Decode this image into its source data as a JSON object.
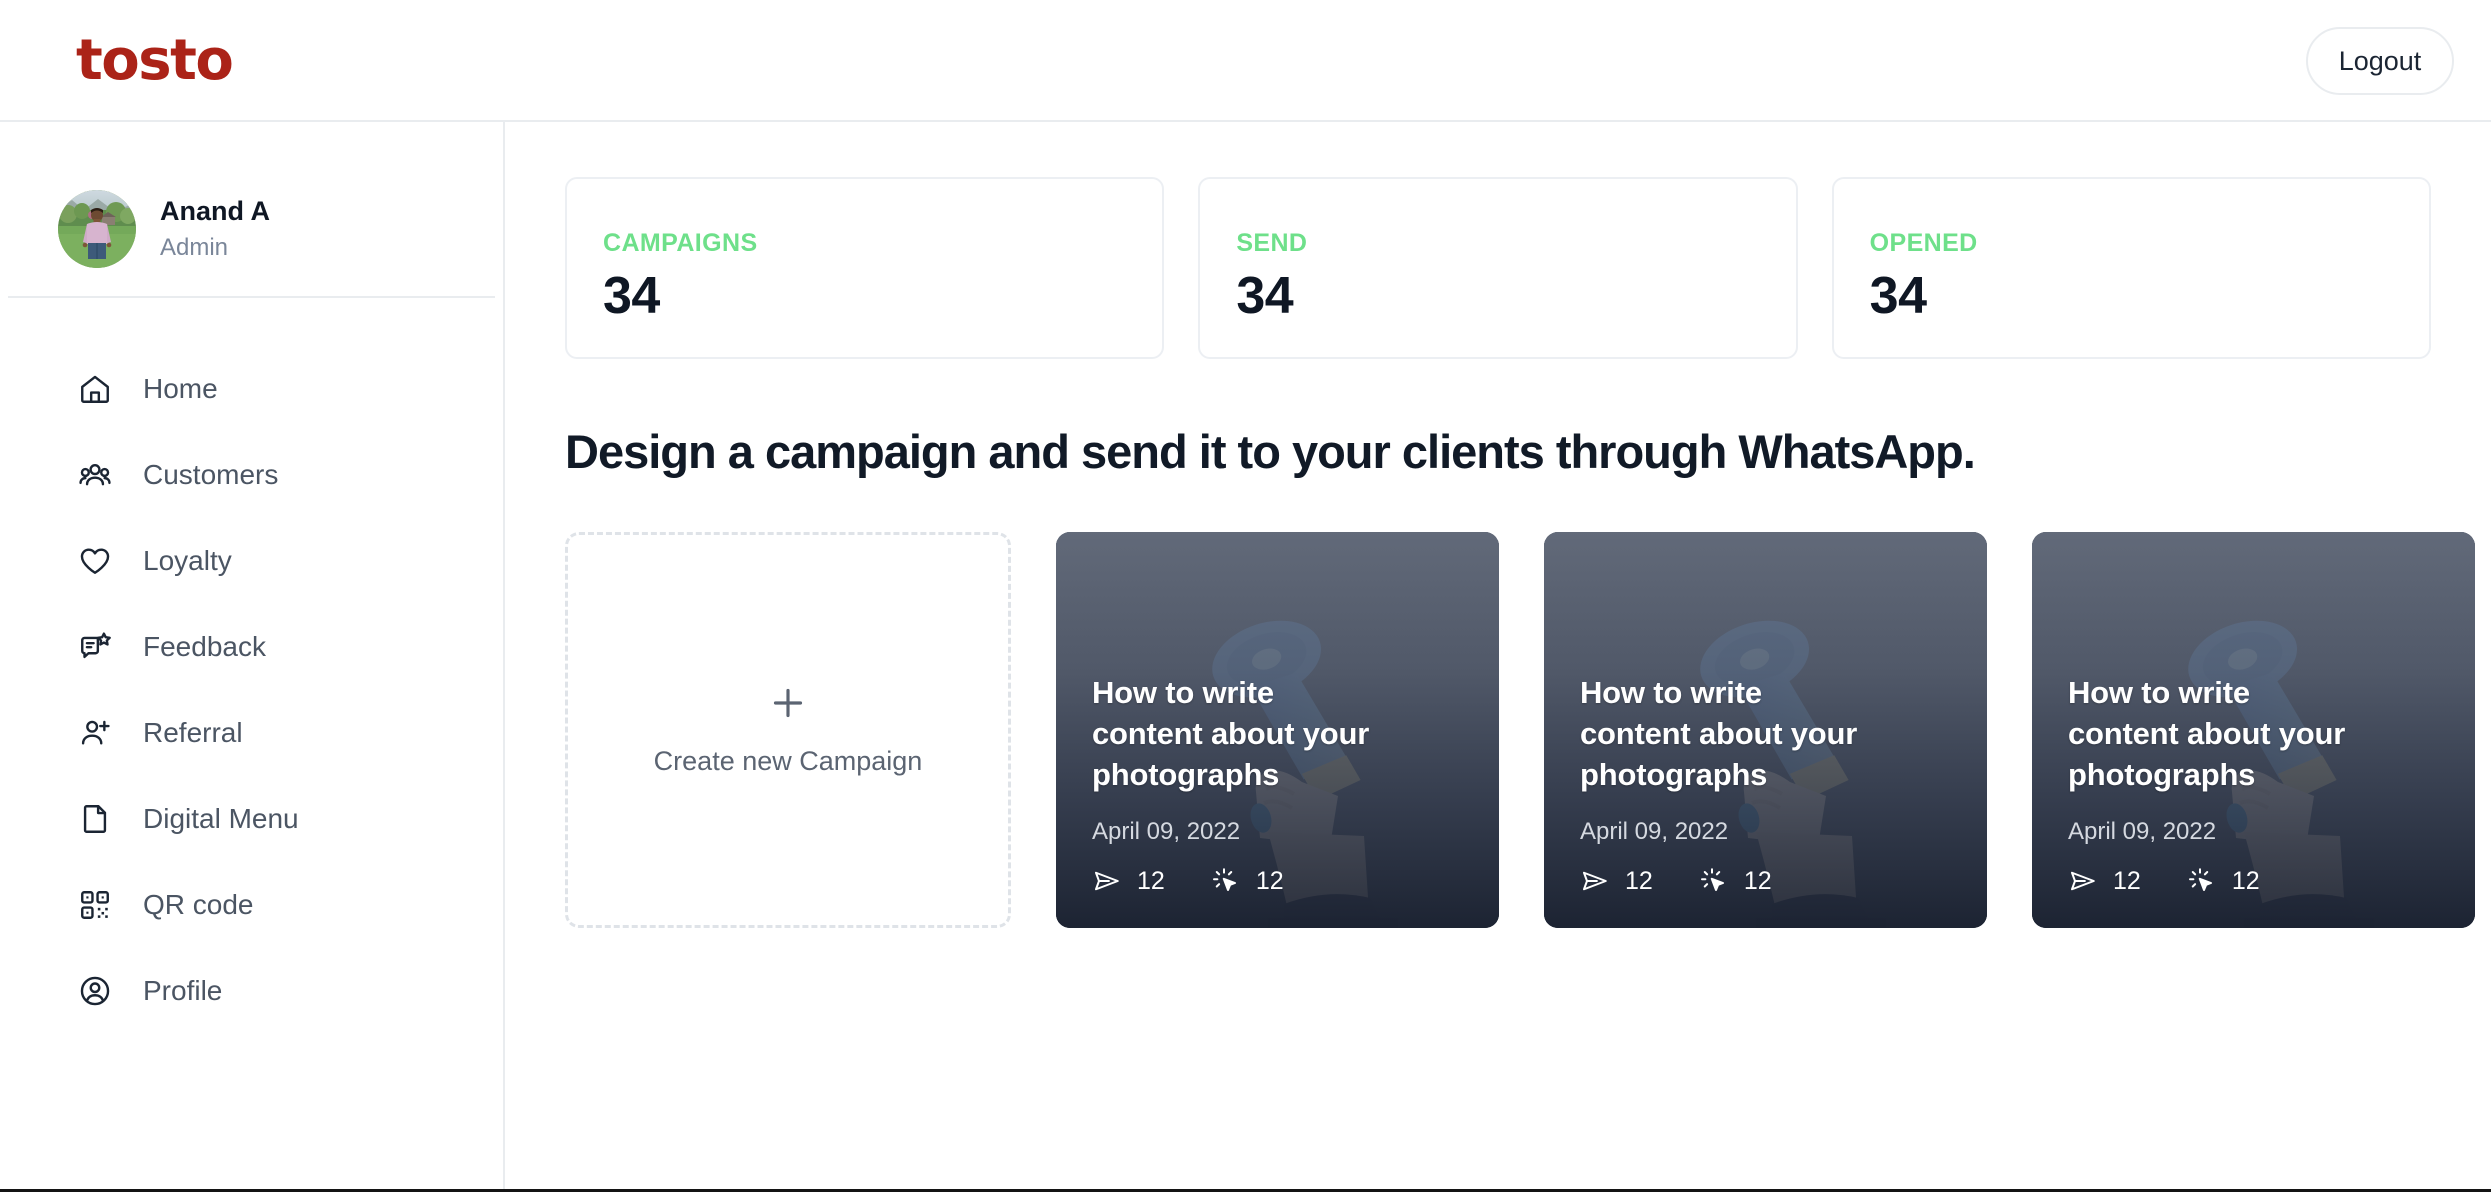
{
  "header": {
    "logo_text": "tosto",
    "logout_label": "Logout"
  },
  "sidebar": {
    "profile": {
      "name": "Anand A",
      "role": "Admin",
      "avatar_icon": "user-photo-avatar"
    },
    "items": [
      {
        "label": "Home",
        "icon": "home-icon"
      },
      {
        "label": "Customers",
        "icon": "customers-icon"
      },
      {
        "label": "Loyalty",
        "icon": "heart-icon"
      },
      {
        "label": "Feedback",
        "icon": "feedback-card-star-icon"
      },
      {
        "label": "Referral",
        "icon": "user-plus-icon"
      },
      {
        "label": "Digital Menu",
        "icon": "document-icon"
      },
      {
        "label": "QR code",
        "icon": "qr-code-icon"
      },
      {
        "label": "Profile",
        "icon": "user-circle-icon"
      }
    ]
  },
  "main": {
    "stats": [
      {
        "label": "CAMPAIGNS",
        "value": "34"
      },
      {
        "label": "SEND",
        "value": "34"
      },
      {
        "label": "OPENED",
        "value": "34"
      }
    ],
    "section_title": "Design a campaign and send it to your clients through WhatsApp.",
    "create_card": {
      "label": "Create new Campaign",
      "icon": "plus-icon"
    },
    "campaigns": [
      {
        "title": "How to write content about your photographs",
        "date": "April 09, 2022",
        "sent_count": "12",
        "clicked_count": "12",
        "sent_icon": "send-paper-plane-icon",
        "clicked_icon": "cursor-click-icon"
      },
      {
        "title": "How to write content about your photographs",
        "date": "April 09, 2022",
        "sent_count": "12",
        "clicked_count": "12",
        "sent_icon": "send-paper-plane-icon",
        "clicked_icon": "cursor-click-icon"
      },
      {
        "title": "How to write content about your photographs",
        "date": "April 09, 2022",
        "sent_count": "12",
        "clicked_count": "12",
        "sent_icon": "send-paper-plane-icon",
        "clicked_icon": "cursor-click-icon"
      }
    ]
  },
  "colors": {
    "brand_red": "#ab2318",
    "stat_label_green": "#6ee08a",
    "text_dark": "#0f1724",
    "text_muted": "#7a8699",
    "border": "#e9ecef"
  }
}
